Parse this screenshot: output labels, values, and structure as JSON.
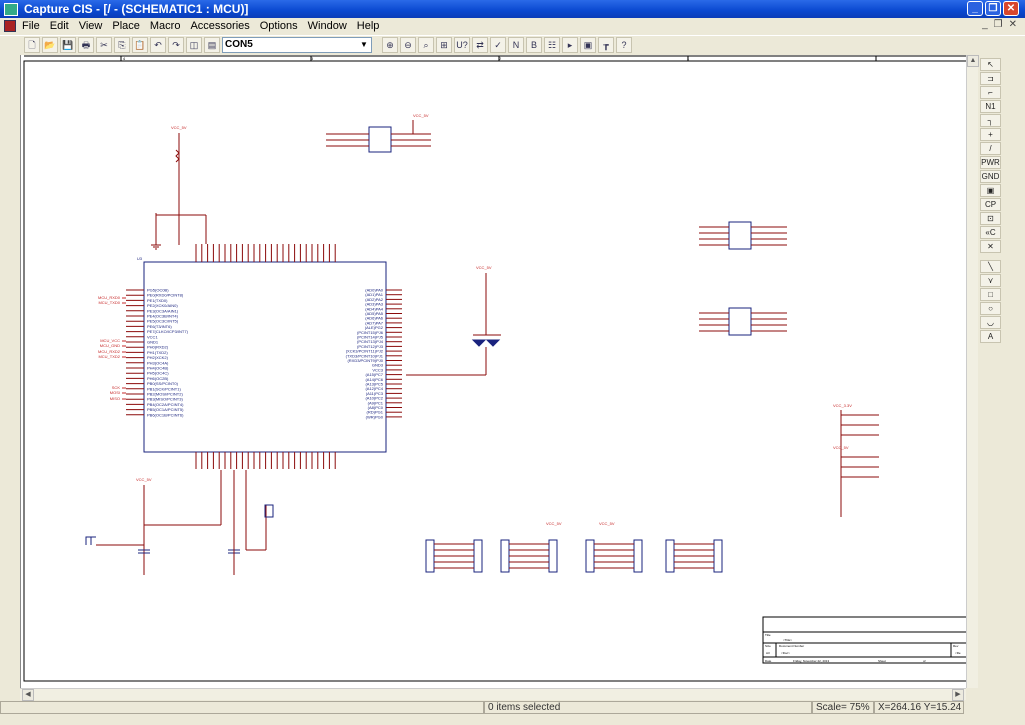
{
  "window": {
    "title": "Capture CIS - [/ - (SCHEMATIC1 : MCU)]",
    "minimize": "_",
    "restore": "❐",
    "close": "✕"
  },
  "menu": [
    "File",
    "Edit",
    "View",
    "Place",
    "Macro",
    "Accessories",
    "Options",
    "Window",
    "Help"
  ],
  "toolbar": {
    "part_combo_value": "CON5",
    "buttons_left": [
      "new",
      "open",
      "save",
      "print",
      "cut",
      "copy",
      "paste",
      "undo",
      "redo",
      "tile",
      "cascade"
    ],
    "buttons_right": [
      "zoom-in",
      "zoom-out",
      "zoom-area",
      "zoom-all",
      "annotate",
      "back-annotate",
      "drc",
      "netlist",
      "bom",
      "props",
      "project",
      "schematic",
      "hierarchy",
      "help"
    ]
  },
  "palette": [
    {
      "icon": "select-icon",
      "g": "↖"
    },
    {
      "icon": "place-part-icon",
      "g": "⊐"
    },
    {
      "icon": "place-wire-icon",
      "g": "⌐"
    },
    {
      "icon": "place-net-alias-icon",
      "g": "N1"
    },
    {
      "icon": "place-bus-icon",
      "g": "┐"
    },
    {
      "icon": "place-junction-icon",
      "g": "+"
    },
    {
      "icon": "place-bus-entry-icon",
      "g": "/"
    },
    {
      "icon": "place-power-icon",
      "g": "PWR"
    },
    {
      "icon": "place-ground-icon",
      "g": "GND"
    },
    {
      "icon": "place-hierarchical-block-icon",
      "g": "▣"
    },
    {
      "icon": "place-port-icon",
      "g": "CP"
    },
    {
      "icon": "place-pin-icon",
      "g": "⊡"
    },
    {
      "icon": "place-off-page-icon",
      "g": "«C"
    },
    {
      "icon": "place-no-connect-icon",
      "g": "✕"
    },
    {
      "icon": "place-line-icon",
      "g": "╲"
    },
    {
      "icon": "place-polyline-icon",
      "g": "⋎"
    },
    {
      "icon": "place-rectangle-icon",
      "g": "□"
    },
    {
      "icon": "place-ellipse-icon",
      "g": "○"
    },
    {
      "icon": "place-arc-icon",
      "g": "◡"
    },
    {
      "icon": "place-text-icon",
      "g": "A"
    }
  ],
  "status": {
    "selection": "0 items selected",
    "scale": "Scale= 75%",
    "coords": "X=264.16  Y=15.24"
  },
  "schematic": {
    "zones": [
      "4",
      "3",
      "2",
      "1"
    ],
    "mcu_ref": "U3",
    "left_pins": [
      "PG5(OC0B)",
      "PE0(RXD0/PCINT8)",
      "PE1(TXD0)",
      "PE2(XCK0/AIN0)",
      "PE3(OC3A/AIN1)",
      "PE4(OC3B/INT4)",
      "PE5(OC3C/INT5)",
      "PE6(T3/INT6)",
      "PE7(CLKO/ICP3/INT7)",
      "VCC1",
      "GND1",
      "PH0(RXD2)",
      "PH1(TXD2)",
      "PH2(XCK2)",
      "PH3(OC4A)",
      "PH4(OC4B)",
      "PH5(OC4C)",
      "PH6(OC2B)",
      "PB0(SS/PCINT0)",
      "PB1(SCK/PCINT1)",
      "PB2(MOSI/PCINT2)",
      "PB3(MISO/PCINT3)",
      "PB4(OC2A/PCINT4)",
      "PB5(OC1A/PCINT5)",
      "PB6(OC1B/PCINT6)"
    ],
    "right_pins": [
      "(AD0)PA0",
      "(AD1)PA1",
      "(AD2)PA2",
      "(AD3)PA3",
      "(AD4)PA4",
      "(AD5)PA5",
      "(AD6)PA6",
      "(AD7)PA7",
      "(ALE)PG2",
      "(PCINT15)PJ6",
      "(PCINT14)PJ5",
      "(PCINT13)PJ4",
      "(PCINT12)PJ3",
      "(XCK3/PCINT11)PJ2",
      "(TXD3/PCINT10)PJ1",
      "(RXD3/PCINT9)PJ0",
      "GND3",
      "VCC3",
      "(A15)PC7",
      "(A14)PC6",
      "(A13)PC5",
      "(A12)PC4",
      "(A11)PC3",
      "(A10)PC2",
      "(A9)PC1",
      "(A8)PC0",
      "(RD)PG1",
      "(WR)PG0"
    ],
    "net_labels_left": [
      "MCU_RXD0",
      "MCU_TXD0",
      "MCU_VCC",
      "MCU_GND",
      "MCU_RXD2",
      "MCU_TXD2",
      "SCK",
      "MOSI",
      "MISO"
    ],
    "power_labels": [
      "VCC_5V",
      "VCC_5V",
      "VCC_5V",
      "VCC_3.3V",
      "VCC_5V",
      "VCC_5V",
      "VCC_5V"
    ],
    "title_block": {
      "title_label": "Title",
      "title": "<Title>",
      "size_label": "Size",
      "size": "A3",
      "docnum_label": "Document Number",
      "docnum": "<Doc>",
      "rev_label": "Rev",
      "rev": "<Re",
      "date_label": "Date",
      "date": "Friday, November 22, 2013",
      "sheet_label": "Sheet",
      "sheet_of": "of"
    }
  },
  "colors": {
    "wire": "#8b0a0a",
    "part": "#1a237e",
    "net": "#c62828",
    "titlebar": "#0a48d0"
  }
}
